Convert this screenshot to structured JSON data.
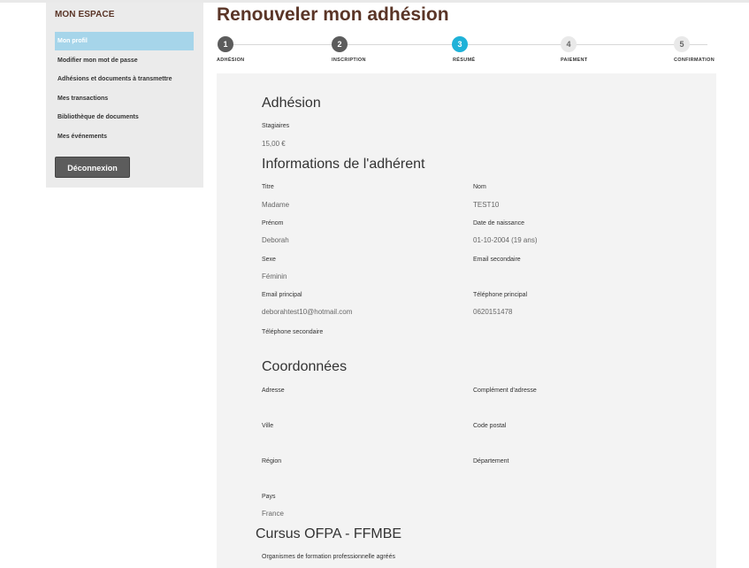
{
  "sidebar": {
    "title": "MON ESPACE",
    "items": [
      {
        "label": "Mon profil"
      },
      {
        "label": "Modifier mon mot de passe"
      },
      {
        "label": "Adhésions et documents à transmettre"
      },
      {
        "label": "Mes transactions"
      },
      {
        "label": "Bibliothèque de documents"
      },
      {
        "label": "Mes événements"
      }
    ],
    "logout_label": "Déconnexion"
  },
  "page": {
    "title": "Renouveler mon adhésion"
  },
  "stepper": {
    "steps": [
      {
        "number": "1",
        "label": "ADHÉSION",
        "state": "done"
      },
      {
        "number": "2",
        "label": "INSCRIPTION",
        "state": "done"
      },
      {
        "number": "3",
        "label": "RÉSUMÉ",
        "state": "current"
      },
      {
        "number": "4",
        "label": "PAIEMENT",
        "state": "todo"
      },
      {
        "number": "5",
        "label": "CONFIRMATION",
        "state": "todo"
      }
    ]
  },
  "adhesion": {
    "heading": "Adhésion",
    "category": "Stagiaires",
    "price": "15,00 €"
  },
  "member": {
    "heading": "Informations de l'adhérent",
    "titre_label": "Titre",
    "titre_value": "Madame",
    "nom_label": "Nom",
    "nom_value": "TEST10",
    "prenom_label": "Prénom",
    "prenom_value": "Deborah",
    "naissance_label": "Date de naissance",
    "naissance_value": "01-10-2004 (19 ans)",
    "sexe_label": "Sexe",
    "sexe_value": "Féminin",
    "email2_label": "Email secondaire",
    "email1_label": "Email principal",
    "email1_value": "deborahtest10@hotmail.com",
    "tel1_label": "Téléphone principal",
    "tel1_value": "0620151478",
    "tel2_label": "Téléphone secondaire"
  },
  "coordonnees": {
    "heading": "Coordonnées",
    "adresse_label": "Adresse",
    "complement_label": "Complément d'adresse",
    "ville_label": "Ville",
    "cp_label": "Code postal",
    "region_label": "Région",
    "departement_label": "Département",
    "pays_label": "Pays",
    "pays_value": "France"
  },
  "cursus": {
    "heading": "Cursus OFPA - FFMBE",
    "organismes_label": "Organismes de formation professionnelle agréés"
  }
}
